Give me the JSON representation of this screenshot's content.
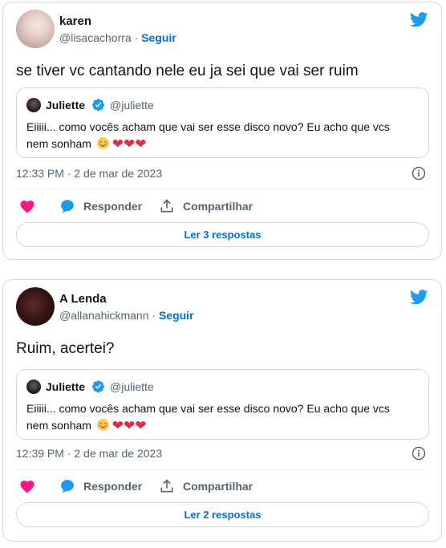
{
  "tweets": [
    {
      "author_name": "karen",
      "author_handle": "@lisacachorra",
      "separator": "·",
      "follow_label": "Seguir",
      "text": "se tiver vc cantando nele eu ja sei que vai ser ruim",
      "quote": {
        "author_name": "Juliette",
        "author_handle": "@juliette",
        "text": "Eiiiii... como vocês acham que vai ser esse disco novo? Eu acho que vcs nem sonham",
        "emojis": "❤❤❤"
      },
      "time": "12:33 PM · 2 de mar de 2023",
      "reply_label": "Responder",
      "share_label": "Compartilhar",
      "read_replies_label": "Ler 3 respostas"
    },
    {
      "author_name": "A Lenda",
      "author_handle": "@allanahickmann",
      "separator": "·",
      "follow_label": "Seguir",
      "text": "Ruim, acertei?",
      "quote": {
        "author_name": "Juliette",
        "author_handle": "@juliette",
        "text": "Eiiiii... como vocês acham que vai ser esse disco novo? Eu acho que vcs nem sonham",
        "emojis": "❤❤❤"
      },
      "time": "12:39 PM · 2 de mar de 2023",
      "reply_label": "Responder",
      "share_label": "Compartilhar",
      "read_replies_label": "Ler 2 respostas"
    }
  ],
  "icons": {
    "brand": "twitter-bird-icon",
    "verified": "verified-badge-icon",
    "info": "info-icon",
    "like": "heart-icon",
    "reply": "reply-bubble-icon",
    "share": "share-icon"
  },
  "colors": {
    "brand_blue": "#1d9bf0",
    "link_blue": "#006fd6",
    "like_pink": "#f91880",
    "border": "#cfd9de",
    "muted_text": "#536471"
  }
}
